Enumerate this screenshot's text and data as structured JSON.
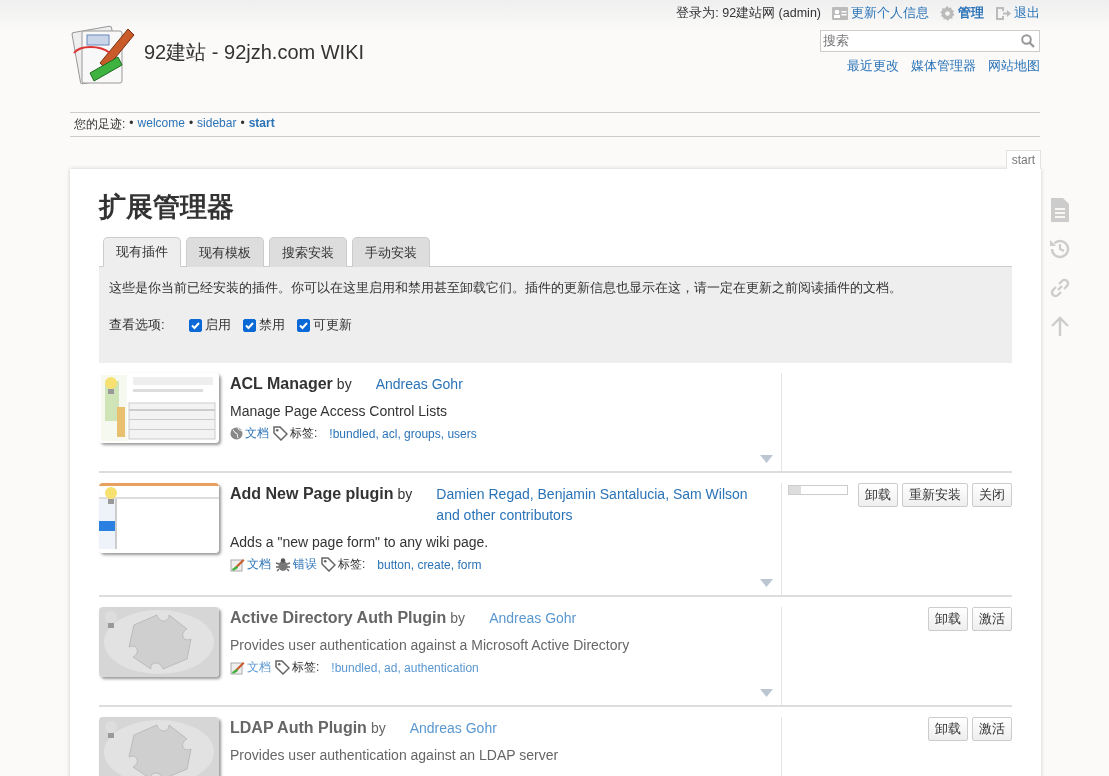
{
  "user_bar": {
    "login_label": "登录为: 92建站网 (admin)",
    "links": [
      {
        "kind": "profile",
        "label": "更新个人信息"
      },
      {
        "kind": "admin",
        "label": "管理"
      },
      {
        "kind": "logout",
        "label": "退出"
      }
    ]
  },
  "site_title": "92建站 - 92jzh.com WIKI",
  "search": {
    "placeholder": "搜索"
  },
  "site_tools": [
    "最近更改",
    "媒体管理器",
    "网站地图"
  ],
  "breadcrumbs": {
    "label": "您的足迹:",
    "items": [
      {
        "bullet": "•",
        "label": "welcome",
        "current": false
      },
      {
        "bullet": "•",
        "label": "sidebar",
        "current": false
      },
      {
        "bullet": "•",
        "label": "start",
        "current": true
      }
    ]
  },
  "page_tab": "start",
  "heading": "扩展管理器",
  "tabs": [
    {
      "label": "现有插件",
      "selected": true
    },
    {
      "label": "现有模板",
      "selected": false
    },
    {
      "label": "搜索安装",
      "selected": false
    },
    {
      "label": "手动安装",
      "selected": false
    }
  ],
  "intro": "这些是你当前已经安装的插件。你可以在这里启用和禁用甚至卸载它们。插件的更新信息也显示在这，请一定在更新之前阅读插件的文档。",
  "view_options": {
    "label": "查看选项:",
    "options": [
      {
        "label": "启用",
        "checked": true
      },
      {
        "label": "禁用",
        "checked": true
      },
      {
        "label": "可更新",
        "checked": true
      }
    ]
  },
  "plugins": [
    {
      "kind": "screenshot",
      "name": "ACL Manager",
      "by": "by",
      "author": "Andreas Gohr",
      "enabled": true,
      "description": "Manage Page Access Control Lists",
      "links": [
        {
          "kind": "globe",
          "label": "文档"
        }
      ],
      "tags_label": "标签:",
      "tags": "!bundled, acl, groups, users"
    },
    {
      "kind": "form",
      "name": "Add New Page plugin",
      "by": "by",
      "author": "Damien Regad, Benjamin Santalucia, Sam Wilson and other contributors",
      "enabled": true,
      "description": "Adds a \"new page form\" to any wiki page.",
      "links": [
        {
          "kind": "pencil",
          "label": "文档"
        },
        {
          "kind": "bug",
          "label": "错误"
        }
      ],
      "tags_label": "标签:",
      "tags": "button, create, form",
      "progress": {
        "level": 0.2
      },
      "buttons": [
        "卸载",
        "重新安装",
        "关闭"
      ]
    },
    {
      "kind": "puzzle",
      "name": "Active Directory Auth Plugin",
      "by": "by",
      "author": "Andreas Gohr",
      "enabled": false,
      "description": "Provides user authentication against a Microsoft Active Directory",
      "links": [
        {
          "kind": "pencil",
          "label": "文档"
        }
      ],
      "tags_label": "标签:",
      "tags": "!bundled, ad, authentication",
      "buttons": [
        "卸载",
        "激活"
      ]
    },
    {
      "kind": "puzzle",
      "name": "LDAP Auth Plugin",
      "by": "by",
      "author": "Andreas Gohr",
      "enabled": false,
      "description": "Provides user authentication against an LDAP server",
      "buttons": [
        "卸载",
        "激活"
      ]
    }
  ]
}
